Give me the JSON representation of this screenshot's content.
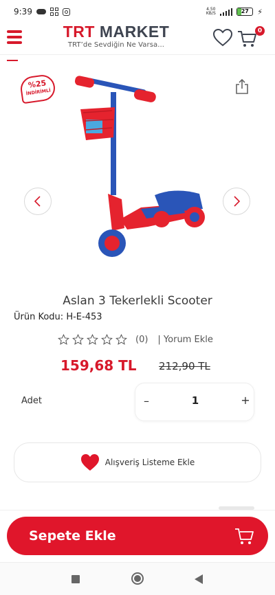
{
  "status_bar": {
    "time": "9:39",
    "network": "4.50",
    "network_unit": "KB/S",
    "battery_level": "27"
  },
  "header": {
    "logo_trt": "TRT",
    "logo_market": "MARKET",
    "tagline": "TRT’de Sevdiğin Ne Varsa...",
    "cart_count": "0"
  },
  "gallery": {
    "badge_percent": "%25",
    "badge_text": "İNDİRİMLİ"
  },
  "product": {
    "title": "Aslan 3 Tekerlekli Scooter",
    "code_label": "Ürün Kodu:",
    "code": "H-E-453",
    "rating_stars": 0,
    "rating_count": "(0)",
    "review_link": "| Yorum Ekle",
    "price_new": "159,68 TL",
    "price_old": "212,90 TL"
  },
  "quantity": {
    "label": "Adet",
    "minus": "–",
    "value": "1",
    "plus": "+"
  },
  "wishlist": {
    "label": "Alışveriş Listeme Ekle"
  },
  "add_to_cart": {
    "label": "Sepete Ekle"
  },
  "colors": {
    "brand_red": "#d7192b",
    "logo_gray": "#3e4450"
  }
}
